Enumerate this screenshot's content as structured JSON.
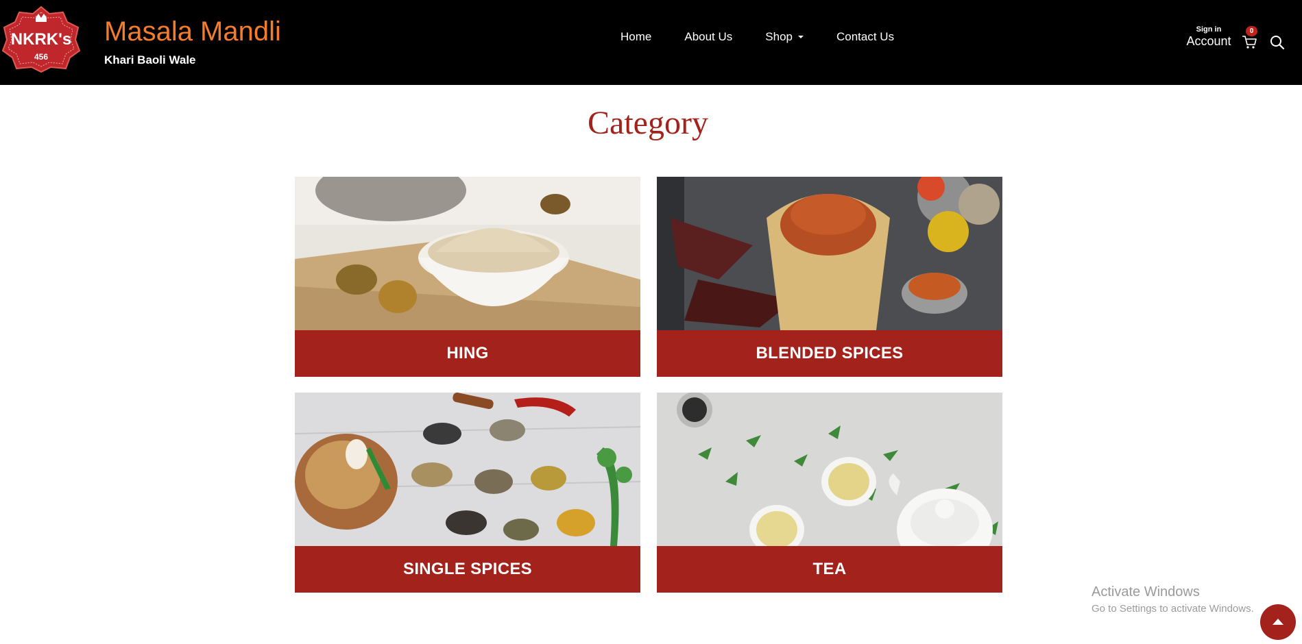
{
  "brand": {
    "logo_text": "NKRK's",
    "logo_number": "456",
    "title": "Masala Mandli",
    "subtitle": "Khari Baoli Wale"
  },
  "nav": {
    "items": [
      {
        "label": "Home"
      },
      {
        "label": "About Us"
      },
      {
        "label": "Shop"
      },
      {
        "label": "Contact Us"
      }
    ]
  },
  "account": {
    "signin_label": "Sign in",
    "account_label": "Account",
    "cart_count": "0"
  },
  "icons": {
    "cart": "cart-icon",
    "search": "search-icon",
    "scroll_top": "arrow-up-icon"
  },
  "main": {
    "title": "Category",
    "categories": [
      {
        "label": "HING"
      },
      {
        "label": "BLENDED SPICES"
      },
      {
        "label": "SINGLE SPICES"
      },
      {
        "label": "TEA"
      }
    ]
  },
  "watermark": {
    "line1": "Activate Windows",
    "line2": "Go to Settings to activate Windows."
  },
  "colors": {
    "header_bg": "#000000",
    "brand_orange": "#f47c2a",
    "accent_red": "#a3221b"
  }
}
